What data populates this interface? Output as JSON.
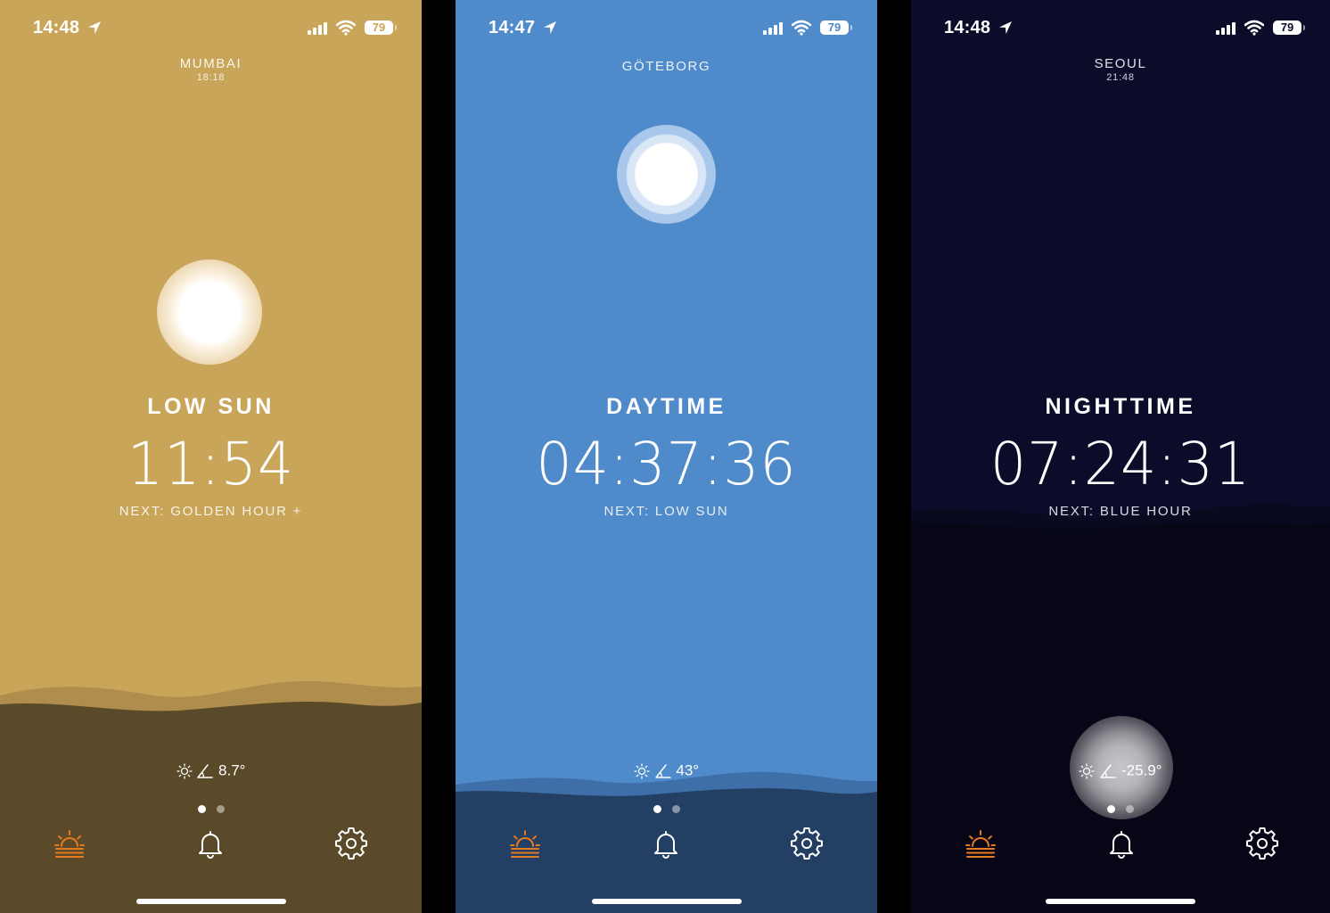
{
  "colors": {
    "tab_active": "#e57a1f",
    "mumbai_sky": "#c9a55a",
    "goteborg_sky": "#4f8acb",
    "seoul_sky": "#0b0b2a"
  },
  "screens": [
    {
      "status_time": "14:48",
      "battery": "79",
      "city": "MUMBAI",
      "city_time": "18:18",
      "phase": "LOW SUN",
      "countdown": "11:54",
      "next": "NEXT: GOLDEN HOUR +",
      "elevation": "8.7°",
      "tabs": [
        "sunrise-icon",
        "bell-icon",
        "gear-icon"
      ],
      "page_indicator": {
        "count": 2,
        "active": 1
      }
    },
    {
      "status_time": "14:47",
      "battery": "79",
      "city": "GÖTEBORG",
      "city_time": "",
      "phase": "DAYTIME",
      "countdown": "04:37:36",
      "next": "NEXT: LOW SUN",
      "elevation": "43°",
      "tabs": [
        "sunrise-icon",
        "bell-icon",
        "gear-icon"
      ],
      "page_indicator": {
        "count": 2,
        "active": 1
      }
    },
    {
      "status_time": "14:48",
      "battery": "79",
      "city": "SEOUL",
      "city_time": "21:48",
      "phase": "NIGHTTIME",
      "countdown": "07:24:31",
      "next": "NEXT: BLUE HOUR",
      "elevation": "-25.9°",
      "tabs": [
        "sunrise-icon",
        "bell-icon",
        "gear-icon"
      ],
      "page_indicator": {
        "count": 2,
        "active": 1
      }
    }
  ]
}
